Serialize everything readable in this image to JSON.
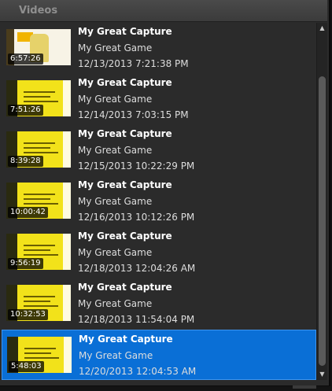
{
  "panel": {
    "title": "Videos"
  },
  "videos": [
    {
      "title": "My Great Capture",
      "game": "My Great Game",
      "date": "12/13/2013 7:21:38 PM",
      "duration": "6:57:26",
      "selected": false
    },
    {
      "title": "My Great Capture",
      "game": "My Great Game",
      "date": "12/14/2013 7:03:15 PM",
      "duration": "7:51:26",
      "selected": false
    },
    {
      "title": "My Great Capture",
      "game": "My Great Game",
      "date": "12/15/2013 10:22:29 PM",
      "duration": "8:39:28",
      "selected": false
    },
    {
      "title": "My Great Capture",
      "game": "My Great Game",
      "date": "12/16/2013 10:12:26 PM",
      "duration": "10:00:42",
      "selected": false
    },
    {
      "title": "My Great Capture",
      "game": "My Great Game",
      "date": "12/18/2013 12:04:26 AM",
      "duration": "9:56:19",
      "selected": false
    },
    {
      "title": "My Great Capture",
      "game": "My Great Game",
      "date": "12/18/2013 11:54:04 PM",
      "duration": "10:32:53",
      "selected": false
    },
    {
      "title": "My Great Capture",
      "game": "My Great Game",
      "date": "12/20/2013 12:04:53 AM",
      "duration": "5:48:03",
      "selected": true
    }
  ],
  "scrollbar": {
    "up_icon": "arrow-up-icon",
    "down_icon": "arrow-down-icon"
  },
  "colors": {
    "selection": "#0a6fd6",
    "background": "#2b2b2b",
    "thumbnail": "#f2e21a"
  }
}
